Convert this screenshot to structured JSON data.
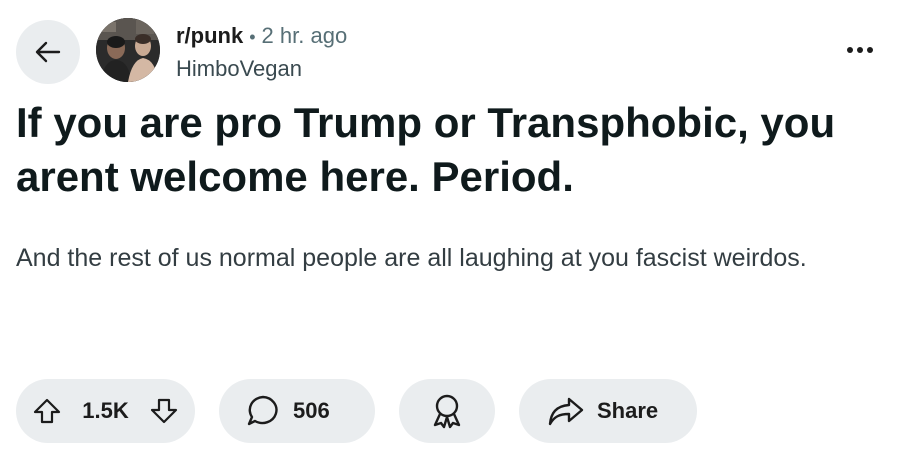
{
  "header": {
    "subreddit": "r/punk",
    "separator": "•",
    "time": "2 hr. ago",
    "username": "HimboVegan"
  },
  "post": {
    "title": "If you are pro Trump or Transphobic, you arent welcome here. Period.",
    "body": "And the rest of us normal people are all laughing at you fascist weirdos."
  },
  "actions": {
    "votes": "1.5K",
    "comments": "506",
    "share_label": "Share"
  },
  "icons": {
    "back": "arrow-left-icon",
    "more": "more-horizontal-icon",
    "upvote": "upvote-arrow-icon",
    "downvote": "downvote-arrow-icon",
    "comment": "comment-bubble-icon",
    "award": "award-icon",
    "share": "share-arrow-icon"
  },
  "colors": {
    "pill_background": "#eaedef",
    "text_primary": "#1c1c1c",
    "text_secondary": "#576f76"
  }
}
